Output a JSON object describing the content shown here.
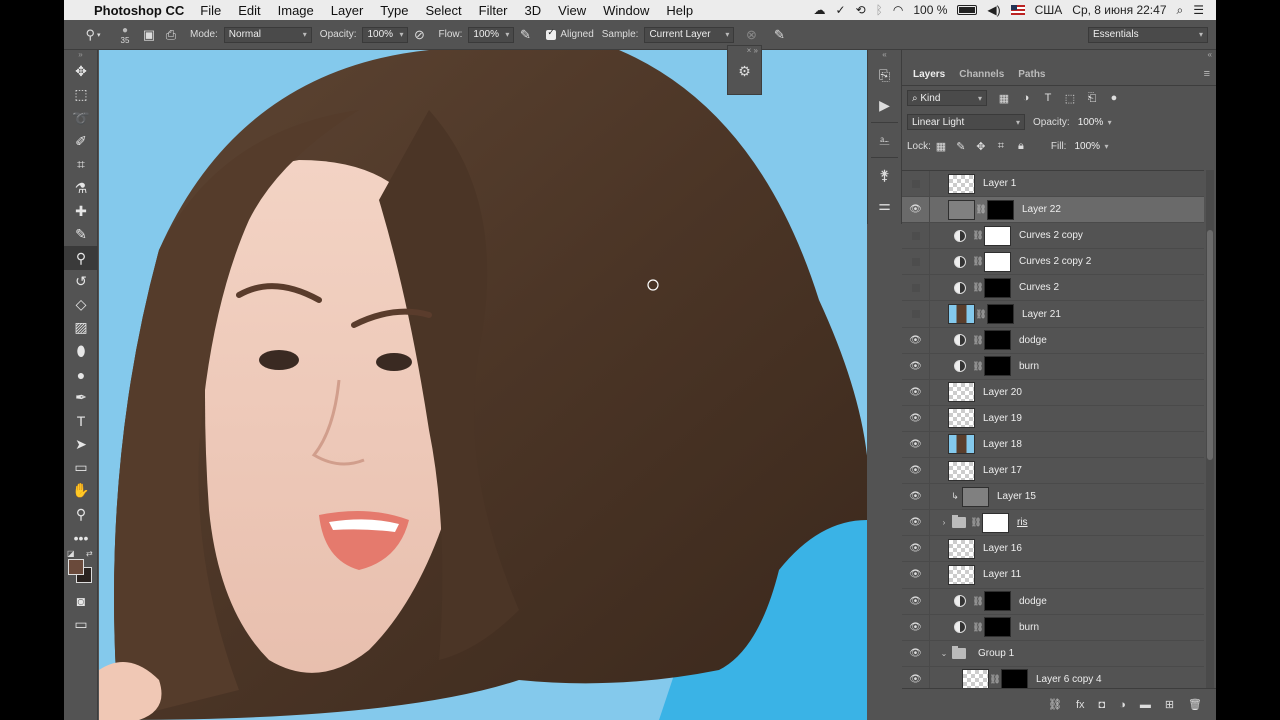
{
  "menubar": {
    "app_name": "Photoshop CC",
    "items": [
      "File",
      "Edit",
      "Image",
      "Layer",
      "Type",
      "Select",
      "Filter",
      "3D",
      "View",
      "Window",
      "Help"
    ],
    "battery": "100 %",
    "locale": "США",
    "datetime": "Ср, 8 июня  22:47"
  },
  "options_bar": {
    "brush_size": "35",
    "mode_label": "Mode:",
    "mode_value": "Normal",
    "opacity_label": "Opacity:",
    "opacity_value": "100%",
    "flow_label": "Flow:",
    "flow_value": "100%",
    "aligned_label": "Aligned",
    "aligned_checked": true,
    "sample_label": "Sample:",
    "sample_value": "Current Layer",
    "workspace_value": "Essentials"
  },
  "toolbar": {
    "tools": [
      "move-tool",
      "marquee-tool",
      "lasso-tool",
      "quick-select-tool",
      "crop-tool",
      "eyedropper-tool",
      "healing-brush-tool",
      "brush-tool",
      "clone-stamp-tool",
      "history-brush-tool",
      "eraser-tool",
      "gradient-tool",
      "blur-tool",
      "dodge-tool",
      "pen-tool",
      "type-tool",
      "path-select-tool",
      "rectangle-tool",
      "hand-tool",
      "zoom-tool",
      "more-tools"
    ],
    "active_tool": "clone-stamp-tool",
    "foreground_color": "#6a4a3b",
    "background_color": "#2a2320"
  },
  "layers_panel": {
    "tabs": [
      "Layers",
      "Channels",
      "Paths"
    ],
    "active_tab": "Layers",
    "filter_kind": "Kind",
    "blend_mode": "Linear Light",
    "opacity_label": "Opacity:",
    "opacity_value": "100%",
    "lock_label": "Lock:",
    "fill_label": "Fill:",
    "fill_value": "100%",
    "layers": [
      {
        "name": "Layer 1",
        "visible": false,
        "type": "pixel",
        "thumb": "check",
        "indent": 1,
        "selected": false
      },
      {
        "name": "Layer 22",
        "visible": true,
        "type": "pixel-mask",
        "thumb": "gray",
        "mask": "black",
        "indent": 1,
        "selected": true
      },
      {
        "name": "Curves 2 copy",
        "visible": false,
        "type": "adjustment",
        "mask": "white",
        "indent": 1,
        "selected": false
      },
      {
        "name": "Curves 2 copy 2",
        "visible": false,
        "type": "adjustment",
        "mask": "white",
        "indent": 1,
        "selected": false
      },
      {
        "name": "Curves 2",
        "visible": false,
        "type": "adjustment",
        "mask": "black",
        "indent": 1,
        "selected": false
      },
      {
        "name": "Layer 21",
        "visible": false,
        "type": "pixel-mask",
        "thumb": "photo",
        "mask": "black",
        "indent": 1,
        "selected": false
      },
      {
        "name": "dodge",
        "visible": true,
        "type": "adjustment",
        "mask": "black",
        "indent": 1,
        "selected": false
      },
      {
        "name": "burn",
        "visible": true,
        "type": "adjustment",
        "mask": "black",
        "indent": 1,
        "selected": false
      },
      {
        "name": "Layer 20",
        "visible": true,
        "type": "pixel",
        "thumb": "check",
        "indent": 1,
        "selected": false
      },
      {
        "name": "Layer 19",
        "visible": true,
        "type": "pixel",
        "thumb": "check",
        "indent": 1,
        "selected": false
      },
      {
        "name": "Layer 18",
        "visible": true,
        "type": "pixel",
        "thumb": "photo",
        "indent": 1,
        "selected": false
      },
      {
        "name": "Layer 17",
        "visible": true,
        "type": "pixel",
        "thumb": "check",
        "indent": 1,
        "selected": false
      },
      {
        "name": "Layer 15",
        "visible": true,
        "type": "clipped",
        "thumb": "gray",
        "indent": 1,
        "selected": false
      },
      {
        "name": "ris",
        "visible": true,
        "type": "group-mask",
        "mask": "white",
        "indent": 0,
        "selected": false,
        "underline": true
      },
      {
        "name": "Layer 16",
        "visible": true,
        "type": "pixel",
        "thumb": "check",
        "indent": 1,
        "selected": false
      },
      {
        "name": "Layer 11",
        "visible": true,
        "type": "pixel",
        "thumb": "check",
        "indent": 1,
        "selected": false
      },
      {
        "name": "dodge",
        "visible": true,
        "type": "adjustment",
        "mask": "black",
        "indent": 1,
        "selected": false
      },
      {
        "name": "burn",
        "visible": true,
        "type": "adjustment",
        "mask": "black",
        "indent": 1,
        "selected": false
      },
      {
        "name": "Group 1",
        "visible": true,
        "type": "group-open",
        "indent": 0,
        "selected": false
      },
      {
        "name": "Layer 6 copy 4",
        "visible": true,
        "type": "pixel-mask",
        "thumb": "check",
        "mask": "black",
        "indent": 2,
        "selected": false
      }
    ]
  }
}
